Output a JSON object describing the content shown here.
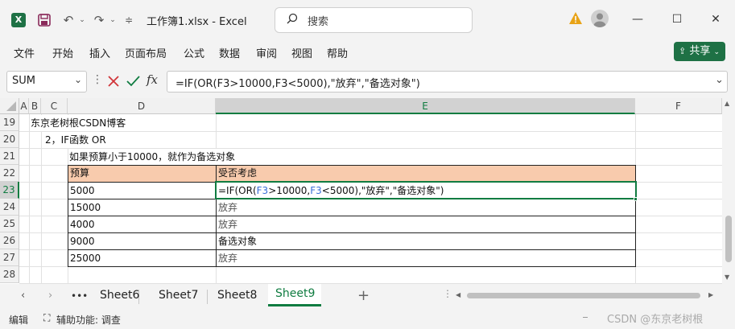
{
  "titlebar": {
    "logo": "X",
    "doc_title": "工作簿1.xlsx  -  Excel",
    "search_placeholder": "搜索"
  },
  "menu": {
    "items": [
      "文件",
      "开始",
      "插入",
      "页面布局",
      "公式",
      "数据",
      "审阅",
      "视图",
      "帮助"
    ],
    "share": "共享"
  },
  "formula_bar": {
    "name_box": "SUM",
    "fx": "fx",
    "formula": "=IF(OR(F3>10000,F3<5000),\"放弃\",\"备选对象\")"
  },
  "grid": {
    "columns": [
      "A",
      "B",
      "C",
      "D",
      "E",
      "F"
    ],
    "rows": [
      "19",
      "20",
      "21",
      "22",
      "23",
      "24",
      "25",
      "26",
      "27",
      "28"
    ],
    "selected_row": "23",
    "selected_col": "E",
    "text_19": "东京老树根CSDN博客",
    "text_20": "2，IF函数 OR",
    "text_21": "如果预算小于10000，就作为备选对象",
    "table_header": [
      "预算",
      "受否考虑"
    ],
    "table_rows": [
      [
        "5000",
        ""
      ],
      [
        "15000",
        "放弃"
      ],
      [
        "4000",
        "放弃"
      ],
      [
        "9000",
        "备选对象"
      ],
      [
        "25000",
        "放弃"
      ]
    ],
    "edit_formula": {
      "p1": "=IF(OR(",
      "ref1": "F3",
      "p2": ">10000,",
      "ref2": "F3",
      "p3": "<5000),\"放弃\",\"备选对象\")"
    },
    "header_fill": "#f8cbad",
    "ref_color": "#3a6fd8"
  },
  "sheets": {
    "more": "•••",
    "tabs": [
      "Sheet6",
      "Sheet7",
      "Sheet8",
      "Sheet9"
    ],
    "active": "Sheet9",
    "add": "+"
  },
  "status": {
    "mode": "编辑",
    "accessibility": "辅助功能: 调查",
    "watermark": "CSDN @东京老树根"
  }
}
